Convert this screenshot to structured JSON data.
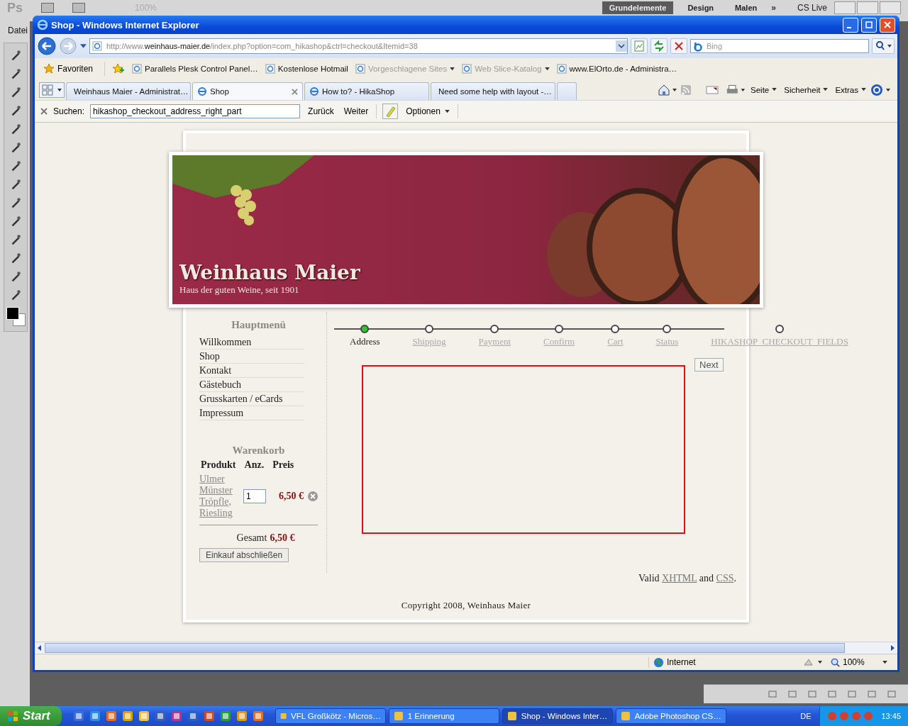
{
  "photoshop": {
    "logo": "Ps",
    "zoom": "100%",
    "workspaces": [
      {
        "label": "Grundelemente",
        "selected": true
      },
      {
        "label": "Design",
        "selected": false
      },
      {
        "label": "Malen",
        "selected": false
      }
    ],
    "more": "»",
    "cs_live": "CS Live",
    "menu": [
      "Datei"
    ]
  },
  "ie": {
    "title": "Shop - Windows Internet Explorer",
    "address": {
      "scheme": "http://www.",
      "host": "weinhaus-maier.de",
      "path": "/index.php?option=com_hikashop&ctrl=checkout&Itemid=38"
    },
    "search": {
      "placeholder": "Bing"
    },
    "favorites": {
      "label": "Favoriten",
      "items": [
        {
          "label": "Parallels Plesk Control Panel…",
          "disabled": false,
          "dropdown": false
        },
        {
          "label": "Kostenlose Hotmail",
          "disabled": false,
          "dropdown": false
        },
        {
          "label": "Vorgeschlagene Sites",
          "disabled": true,
          "dropdown": true
        },
        {
          "label": "Web Slice-Katalog",
          "disabled": true,
          "dropdown": true
        },
        {
          "label": "www.ElOrto.de - Administra…",
          "disabled": false,
          "dropdown": false
        }
      ]
    },
    "tabs": [
      {
        "label": "Weinhaus Maier - Administrat…",
        "selected": false
      },
      {
        "label": "Shop",
        "selected": true
      },
      {
        "label": "How to? - HikaShop",
        "selected": false
      },
      {
        "label": "Need some help with layout -…",
        "selected": false
      }
    ],
    "commands": [
      "Seite",
      "Sicherheit",
      "Extras"
    ],
    "find_bar": {
      "label": "Suchen:",
      "value": "hikashop_checkout_address_right_part",
      "buttons": [
        "Zurück",
        "Weiter"
      ],
      "options": "Optionen"
    },
    "status_bar": {
      "zone": "Internet",
      "zoom": "100%"
    }
  },
  "page": {
    "banner": {
      "logo": "Weinhaus Maier",
      "tagline": "Haus der guten Weine, seit 1901"
    },
    "menu_title": "Hauptmenü",
    "menu": [
      "Willkommen",
      "Shop",
      "Kontakt",
      "Gästebuch",
      "Grusskarten / eCards",
      "Impressum"
    ],
    "cart": {
      "title": "Warenkorb",
      "columns": [
        "Produkt",
        "Anz.",
        "Preis"
      ],
      "items": [
        {
          "product": "Ulmer Münster Tröpfle, Riesling",
          "quantity": "1",
          "price": "6,50 €"
        }
      ],
      "total_label": "Gesamt",
      "total": "6,50 €",
      "checkout": "Einkauf abschließen"
    },
    "steps": [
      {
        "label": "Address",
        "selected": true
      },
      {
        "label": "Shipping",
        "selected": false
      },
      {
        "label": "Payment",
        "selected": false
      },
      {
        "label": "Confirm",
        "selected": false
      },
      {
        "label": "Cart",
        "selected": false
      },
      {
        "label": "Status",
        "selected": false
      },
      {
        "label": "HIKASHOP_CHECKOUT_FIELDS",
        "selected": false
      }
    ],
    "next": "Next",
    "validation": [
      {
        "text": "Valid",
        "link": false
      },
      {
        "text": "XHTML",
        "link": true
      },
      {
        "text": "and",
        "link": false
      },
      {
        "text": "CSS",
        "link": true
      },
      {
        "text": ".",
        "link": false
      }
    ],
    "copyright": "Copyright 2008, Weinhaus Maier"
  },
  "taskbar": {
    "start": "Start",
    "tasks": [
      {
        "label": "VFL Großkötz - Micros…",
        "selected": false
      },
      {
        "label": "1 Erinnerung",
        "selected": false
      },
      {
        "label": "Shop - Windows Inter…",
        "selected": true
      },
      {
        "label": "Adobe Photoshop CS…",
        "selected": false
      }
    ],
    "language": "DE",
    "clock": "13:45"
  }
}
